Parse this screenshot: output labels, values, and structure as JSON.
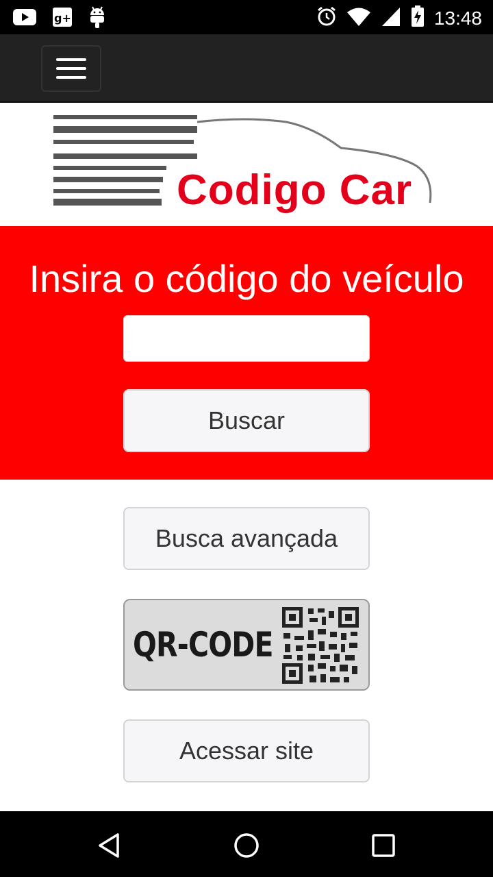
{
  "status_bar": {
    "time": "13:48",
    "left_icons": [
      "youtube-icon",
      "google-plus-icon",
      "android-icon"
    ],
    "right_icons": [
      "alarm-icon",
      "wifi-icon",
      "signal-icon",
      "battery-charging-icon"
    ]
  },
  "navbar": {
    "menu_icon": "hamburger-menu-icon"
  },
  "logo": {
    "text": "Codigo Car",
    "color": "#e4001b"
  },
  "hero": {
    "title": "Insira o código do veículo",
    "input_value": "",
    "input_placeholder": "",
    "search_label": "Buscar",
    "background": "#ff0000"
  },
  "actions": {
    "advanced_label": "Busca avançada",
    "qr_label": "QR-CODE",
    "site_label": "Acessar site"
  },
  "system_nav": {
    "icons": [
      "back-icon",
      "home-icon",
      "recents-icon"
    ]
  }
}
